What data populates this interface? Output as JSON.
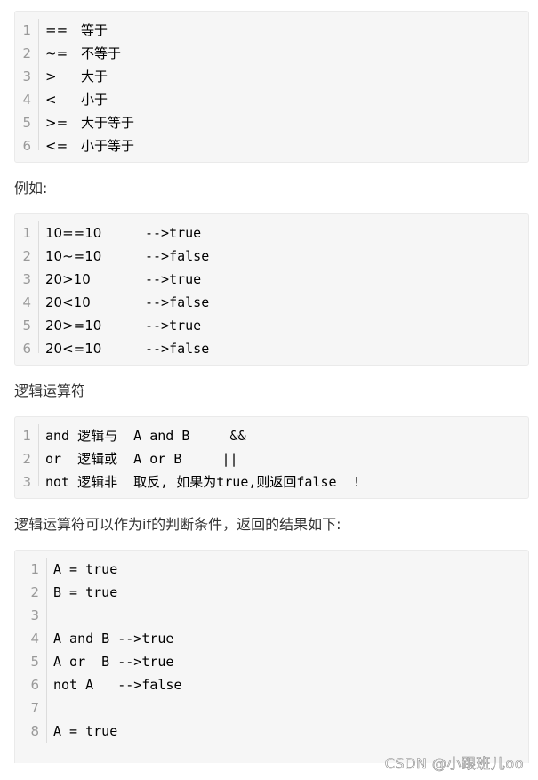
{
  "block1": {
    "lines": [
      {
        "num": "1",
        "op": "==",
        "desc": "等于"
      },
      {
        "num": "2",
        "op": "~=",
        "desc": "不等于"
      },
      {
        "num": "3",
        "op": ">",
        "desc": "大于"
      },
      {
        "num": "4",
        "op": "<",
        "desc": "小于"
      },
      {
        "num": "5",
        "op": ">=",
        "desc": "大于等于"
      },
      {
        "num": "6",
        "op": "<=",
        "desc": "小于等于"
      }
    ]
  },
  "para1": "例如:",
  "block2": {
    "lines": [
      {
        "num": "1",
        "expr": "10==10",
        "result": "-->true"
      },
      {
        "num": "2",
        "expr": "10~=10",
        "result": "-->false"
      },
      {
        "num": "3",
        "expr": "20>10",
        "result": "-->true"
      },
      {
        "num": "4",
        "expr": "20<10",
        "result": "-->false"
      },
      {
        "num": "5",
        "expr": "20>=10",
        "result": "-->true"
      },
      {
        "num": "6",
        "expr": "20<=10",
        "result": "-->false"
      }
    ]
  },
  "para2": "逻辑运算符",
  "block3": {
    "lines": [
      {
        "num": "1",
        "text": "and 逻辑与  A and B     &&"
      },
      {
        "num": "2",
        "text": "or  逻辑或  A or B     ||"
      },
      {
        "num": "3",
        "text": "not 逻辑非  取反, 如果为true,则返回false  !"
      }
    ]
  },
  "para3": "逻辑运算符可以作为if的判断条件，返回的结果如下:",
  "block4": {
    "lines": [
      {
        "num": "1",
        "text": "A = true"
      },
      {
        "num": "2",
        "text": "B = true"
      },
      {
        "num": "3",
        "text": ""
      },
      {
        "num": "4",
        "text": "A and B -->true"
      },
      {
        "num": "5",
        "text": "A or  B -->true"
      },
      {
        "num": "6",
        "text": "not A   -->false"
      },
      {
        "num": "7",
        "text": ""
      },
      {
        "num": "8",
        "text": "A = true"
      }
    ]
  },
  "watermark": "CSDN @小跟班儿oo"
}
